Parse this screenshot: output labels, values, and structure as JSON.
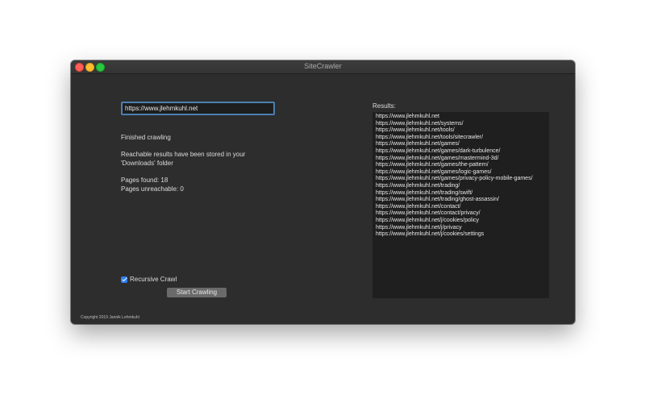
{
  "window": {
    "title": "SiteCrawler"
  },
  "form": {
    "url_value": "https://www.jlehmkuhl.net",
    "status": "Finished crawling",
    "stored_line1": "Reachable results have been stored in your",
    "stored_line2": "'Downloads' folder",
    "pages_found": "Pages found: 18",
    "pages_unreachable": "Pages unreachable: 0",
    "recursive_label": "Recursive Crawl",
    "recursive_checked": true,
    "start_button": "Start Crawling",
    "copyright": "Copyright 2019 Jannik Lehmkuhl"
  },
  "results": {
    "label": "Results:",
    "items": [
      "https://www.jlehmkuhl.net",
      "https://www.jlehmkuhl.net/systems/",
      "https://www.jlehmkuhl.net/tools/",
      "https://www.jlehmkuhl.net/tools/sitecrawler/",
      "https://www.jlehmkuhl.net/games/",
      "https://www.jlehmkuhl.net/games/dark-turbulence/",
      "https://www.jlehmkuhl.net/games/mastermind-3d/",
      "https://www.jlehmkuhl.net/games/the-pattern/",
      "https://www.jlehmkuhl.net/games/logic-games/",
      "https://www.jlehmkuhl.net/games/privacy-policy-mobile-games/",
      "https://www.jlehmkuhl.net/trading/",
      "https://www.jlehmkuhl.net/trading/swift/",
      "https://www.jlehmkuhl.net/trading/ghost-assassin/",
      "https://www.jlehmkuhl.net/contact/",
      "https://www.jlehmkuhl.net/contact/privacy/",
      "https://www.jlehmkuhl.net/j/cookies/policy",
      "https://www.jlehmkuhl.net/j/privacy",
      "https://www.jlehmkuhl.net/j/cookies/settings"
    ]
  },
  "colors": {
    "window_bg": "#2d2d2d",
    "results_bg": "#1f1f1f",
    "accent": "#2f7ff0",
    "focus_ring": "#4a7fb3",
    "button_bg": "#6a6a6a",
    "close": "#ff5f57",
    "minimize": "#febc2e",
    "zoom": "#28c840"
  }
}
